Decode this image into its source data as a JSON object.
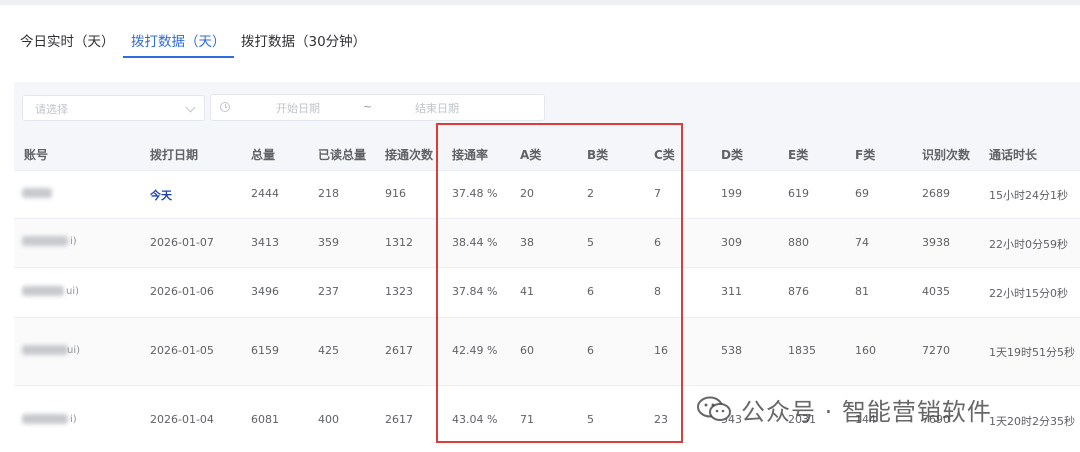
{
  "tabs": [
    {
      "label": "今日实时（天）",
      "active": false
    },
    {
      "label": "拨打数据（天）",
      "active": true
    },
    {
      "label": "拨打数据（30分钟）",
      "active": false
    }
  ],
  "filters": {
    "select_placeholder": "请选择",
    "date_start_placeholder": "开始日期",
    "date_separator": "~",
    "date_end_placeholder": "结束日期"
  },
  "table": {
    "columns": [
      "账号",
      "拨打日期",
      "总量",
      "已读总量",
      "接通次数",
      "接通率",
      "A类",
      "B类",
      "C类",
      "D类",
      "E类",
      "F类",
      "识别次数",
      "通话时长"
    ],
    "rows": [
      {
        "account_suffix": "",
        "date": "今天",
        "total": "2444",
        "read_total": "218",
        "connected": "916",
        "rate": "37.48 %",
        "a": "20",
        "b": "2",
        "c": "7",
        "d": "199",
        "e": "619",
        "f": "69",
        "recognized": "2689",
        "duration": "15小时24分1秒"
      },
      {
        "account_suffix": "i)",
        "date": "2026-01-07",
        "total": "3413",
        "read_total": "359",
        "connected": "1312",
        "rate": "38.44 %",
        "a": "38",
        "b": "5",
        "c": "6",
        "d": "309",
        "e": "880",
        "f": "74",
        "recognized": "3938",
        "duration": "22小时0分59秒"
      },
      {
        "account_suffix": "ui)",
        "date": "2026-01-06",
        "total": "3496",
        "read_total": "237",
        "connected": "1323",
        "rate": "37.84 %",
        "a": "41",
        "b": "6",
        "c": "8",
        "d": "311",
        "e": "876",
        "f": "81",
        "recognized": "4035",
        "duration": "22小时15分0秒"
      },
      {
        "account_suffix": "ui)",
        "date": "2026-01-05",
        "total": "6159",
        "read_total": "425",
        "connected": "2617",
        "rate": "42.49 %",
        "a": "60",
        "b": "6",
        "c": "16",
        "d": "538",
        "e": "1835",
        "f": "160",
        "recognized": "7270",
        "duration": "1天19时51分5秒"
      },
      {
        "account_suffix": "i)",
        "date": "2026-01-04",
        "total": "6081",
        "read_total": "400",
        "connected": "2617",
        "rate": "43.04 %",
        "a": "71",
        "b": "5",
        "c": "23",
        "d": "543",
        "e": "2031",
        "f": "144",
        "recognized": "7690",
        "duration": "1天20时2分35秒"
      }
    ]
  },
  "watermark": {
    "text": "公众号 · 智能营销软件",
    "icon": "wechat-icon"
  },
  "colors": {
    "accent": "#2f6be2",
    "highlight_border": "#e03b3b",
    "today": "#1b3fb8"
  }
}
